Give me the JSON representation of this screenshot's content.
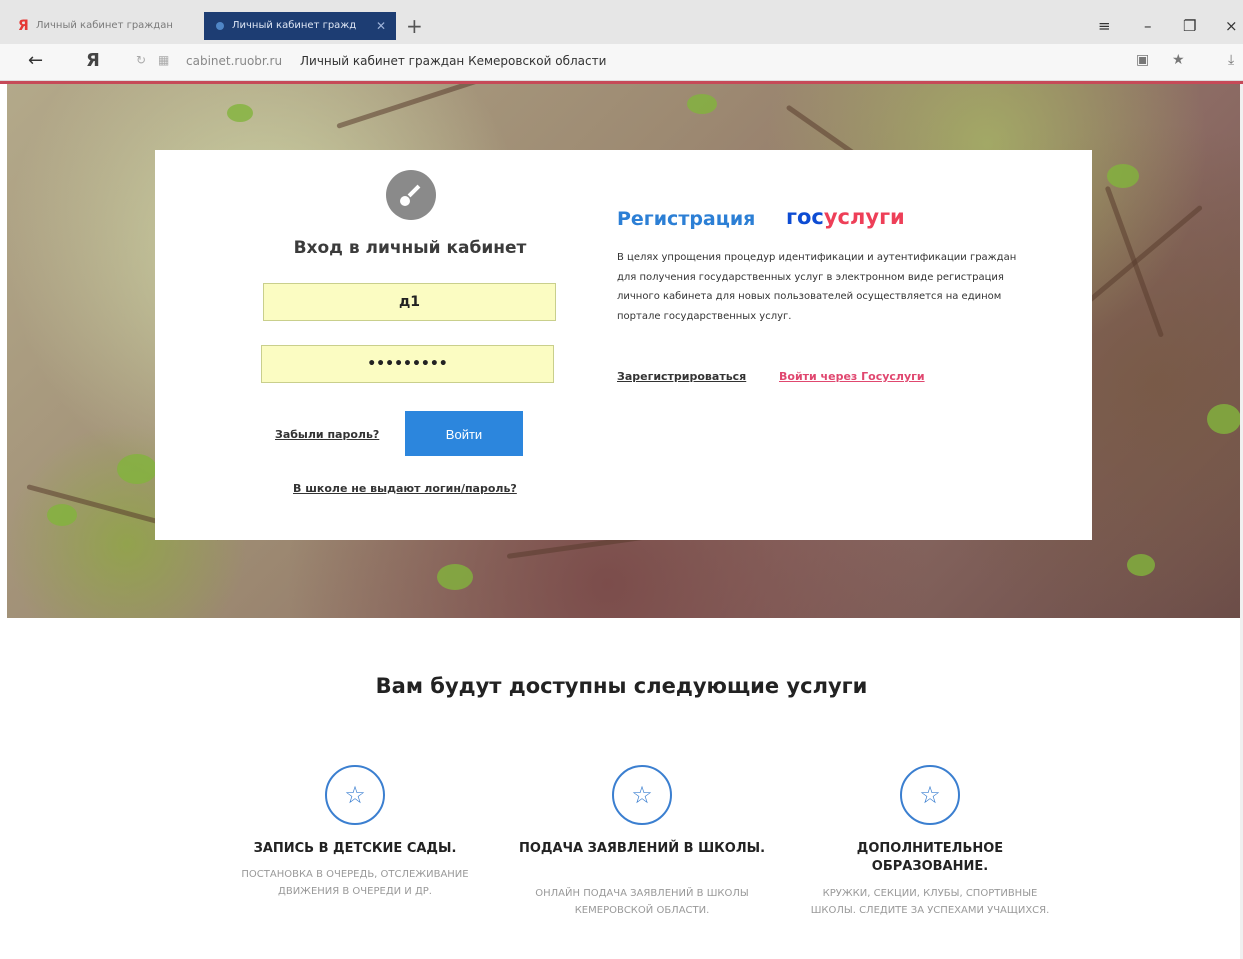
{
  "browser": {
    "tabs": [
      {
        "label": "Личный кабинет граждан",
        "active": false
      },
      {
        "label": "Личный кабинет гражд",
        "active": true
      }
    ],
    "new_tab": "+",
    "window": {
      "menu": "≡",
      "minimize": "–",
      "restore": "❐",
      "close": "×"
    },
    "address": {
      "back": "←",
      "home": "Я",
      "host": "cabinet.ruobr.ru",
      "title": "Личный кабинет граждан Кемеровской области"
    },
    "colors": {
      "tab_active": "#1d3d73",
      "accent_line": "#c64a58"
    }
  },
  "login": {
    "title": "Вход в личный кабинет",
    "login_value": "д1",
    "password_value": "•••••••••",
    "forgot_label": "Забыли пароль?",
    "submit_label": "Войти",
    "no_login_label": "В школе не выдают логин/пароль?",
    "key_icon": "key-icon"
  },
  "registration": {
    "title": "Регистрация",
    "gosuslugi_a": "гос",
    "gosuslugi_b": "услуги",
    "text": "В целях упрощения процедур идентификации и аутентификации граждан для получения государственных услуг в электронном виде регистрация личного кабинета для новых пользователей осуществляется на едином портале государственных услуг.",
    "register_link": "Зарегистрироваться",
    "gosuslugi_link": "Войти через Госуслуги"
  },
  "services": {
    "title": "Вам будут доступны следующие услуги",
    "items": [
      {
        "title": "ЗАПИСЬ В ДЕТСКИЕ САДЫ.",
        "desc": "ПОСТАНОВКА В ОЧЕРЕДЬ, ОТСЛЕЖИВАНИЕ ДВИЖЕНИЯ В ОЧЕРЕДИ И ДР.",
        "icon": "star-icon"
      },
      {
        "title": "ПОДАЧА ЗАЯВЛЕНИЙ В ШКОЛЫ.",
        "desc": "ОНЛАЙН ПОДАЧА ЗАЯВЛЕНИЙ В ШКОЛЫ КЕМЕРОВСКОЙ ОБЛАСТИ.",
        "icon": "star-icon"
      },
      {
        "title": "ДОПОЛНИТЕЛЬНОЕ ОБРАЗОВАНИЕ.",
        "desc": "КРУЖКИ, СЕКЦИИ, КЛУБЫ, СПОРТИВНЫЕ ШКОЛЫ. СЛЕДИТЕ ЗА УСПЕХАМИ УЧАЩИХСЯ.",
        "icon": "star-icon"
      }
    ]
  }
}
